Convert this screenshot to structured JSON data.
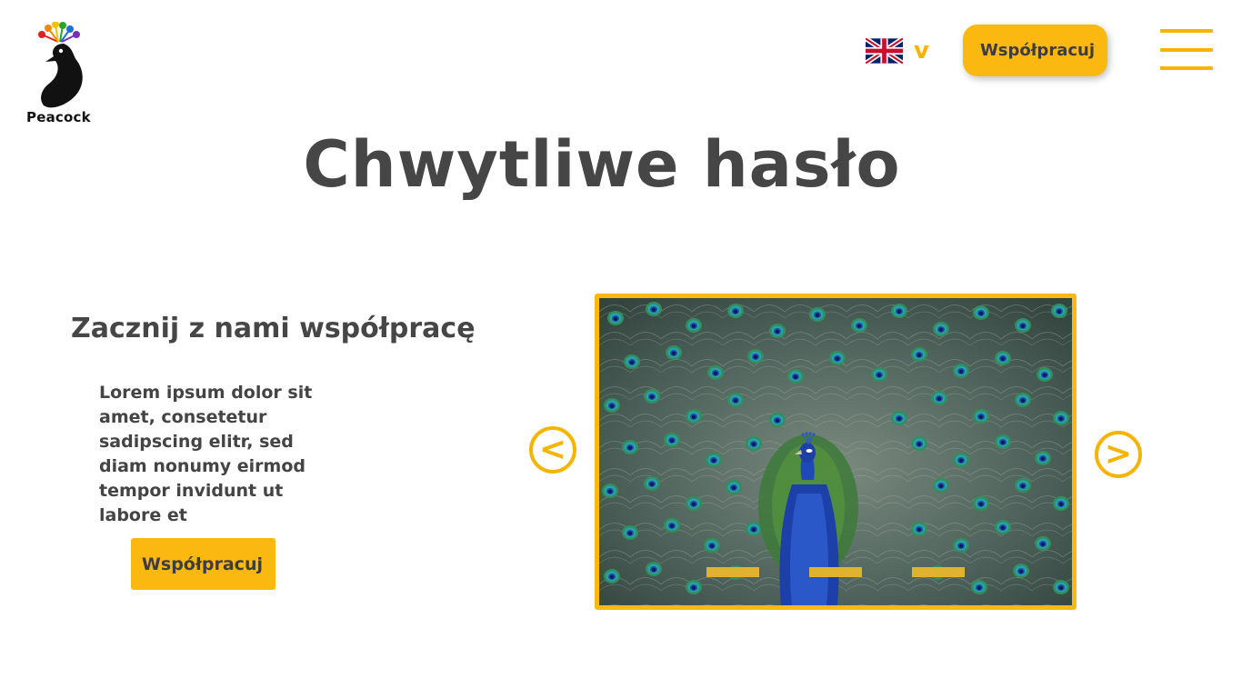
{
  "brand": {
    "name": "Peacock"
  },
  "header": {
    "language": {
      "flag": "uk-flag",
      "caret": "v"
    },
    "cta_label": "Współpracuj",
    "menu_icon": "hamburger-menu-icon"
  },
  "hero": {
    "headline": "Chwytliwe hasło",
    "subheadline": "Zacznij z nami współpracę",
    "body": "Lorem ipsum dolor sit amet, consetetur sadipscing elitr, sed diam nonumy eirmod tempor invidunt ut labore et",
    "cta_label": "Współpracuj"
  },
  "carousel": {
    "prev_label": "<",
    "next_label": ">",
    "slide_image": "peacock-photo",
    "slide_count": 3
  },
  "colors": {
    "accent": "#fbb811",
    "text": "#464646",
    "background": "#ffffff"
  }
}
